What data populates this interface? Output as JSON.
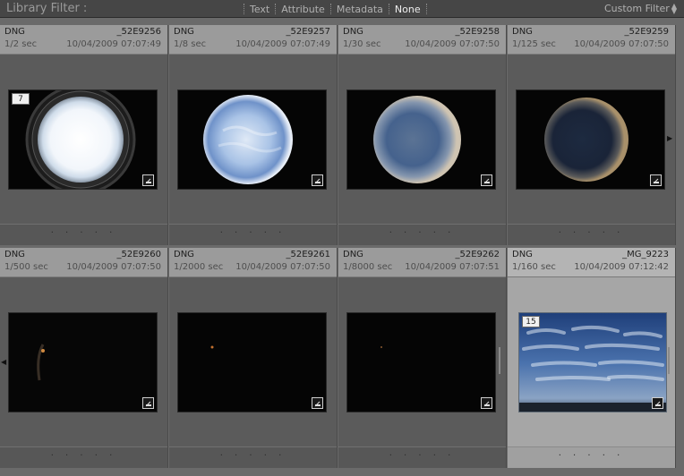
{
  "filter_bar": {
    "title": "Library Filter :",
    "options": [
      "Text",
      "Attribute",
      "Metadata",
      "None"
    ],
    "active_option": "None",
    "custom_filter": "Custom Filter"
  },
  "photos": [
    {
      "ext": "DNG",
      "name": "_52E9256",
      "exposure": "1/2 sec",
      "date": "10/04/2009 07:07:49",
      "badge": "7",
      "rating_dots": "· · · · ·",
      "selected": false
    },
    {
      "ext": "DNG",
      "name": "_52E9257",
      "exposure": "1/8 sec",
      "date": "10/04/2009 07:07:49",
      "badge": "",
      "rating_dots": "· · · · ·",
      "selected": false
    },
    {
      "ext": "DNG",
      "name": "_52E9258",
      "exposure": "1/30 sec",
      "date": "10/04/2009 07:07:50",
      "badge": "",
      "rating_dots": "· · · · ·",
      "selected": false
    },
    {
      "ext": "DNG",
      "name": "_52E9259",
      "exposure": "1/125 sec",
      "date": "10/04/2009 07:07:50",
      "badge": "",
      "rating_dots": "· · · · ·",
      "selected": false
    },
    {
      "ext": "DNG",
      "name": "_52E9260",
      "exposure": "1/500 sec",
      "date": "10/04/2009 07:07:50",
      "badge": "",
      "rating_dots": "· · · · ·",
      "selected": false
    },
    {
      "ext": "DNG",
      "name": "_52E9261",
      "exposure": "1/2000 sec",
      "date": "10/04/2009 07:07:50",
      "badge": "",
      "rating_dots": "· · · · ·",
      "selected": false
    },
    {
      "ext": "DNG",
      "name": "_52E9262",
      "exposure": "1/8000 sec",
      "date": "10/04/2009 07:07:51",
      "badge": "",
      "rating_dots": "· · · · ·",
      "selected": false
    },
    {
      "ext": "DNG",
      "name": "_MG_9223",
      "exposure": "1/160 sec",
      "date": "10/04/2009 07:12:42",
      "badge": "15",
      "rating_dots": "· · · · ·",
      "selected": true
    }
  ],
  "colors": {
    "panel_bg": "#6a6a6a",
    "header_bg": "#9b9b9b",
    "selected_bg": "#a6a6a6",
    "filter_bar_bg": "#464646"
  }
}
